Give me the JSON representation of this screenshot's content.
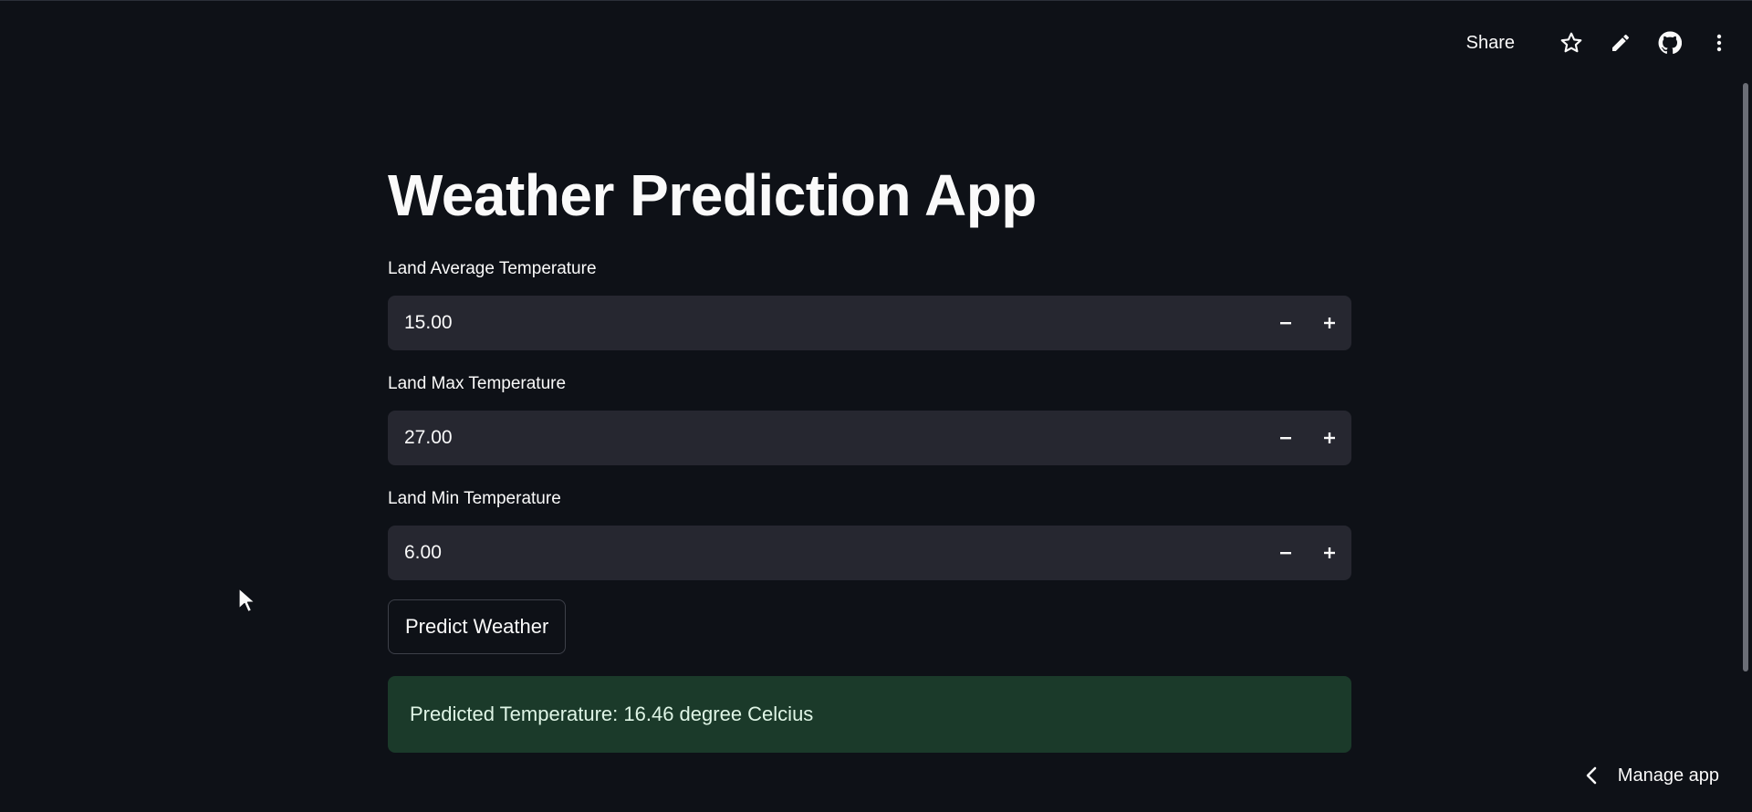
{
  "toolbar": {
    "share_label": "Share",
    "icons": [
      "star-icon",
      "pencil-icon",
      "github-icon",
      "more-vertical-icon"
    ]
  },
  "page": {
    "title": "Weather Prediction App"
  },
  "fields": [
    {
      "label": "Land Average Temperature",
      "value": "15.00"
    },
    {
      "label": "Land Max Temperature",
      "value": "27.00"
    },
    {
      "label": "Land Min Temperature",
      "value": "6.00"
    }
  ],
  "actions": {
    "predict_label": "Predict Weather"
  },
  "result": {
    "text": "Predicted Temperature: 16.46 degree Celcius"
  },
  "footer": {
    "manage_label": "Manage app"
  },
  "colors": {
    "background": "#0e1117",
    "input_bg": "#262730",
    "success_bg": "#1b3a2a",
    "success_text": "#dff5e6"
  }
}
